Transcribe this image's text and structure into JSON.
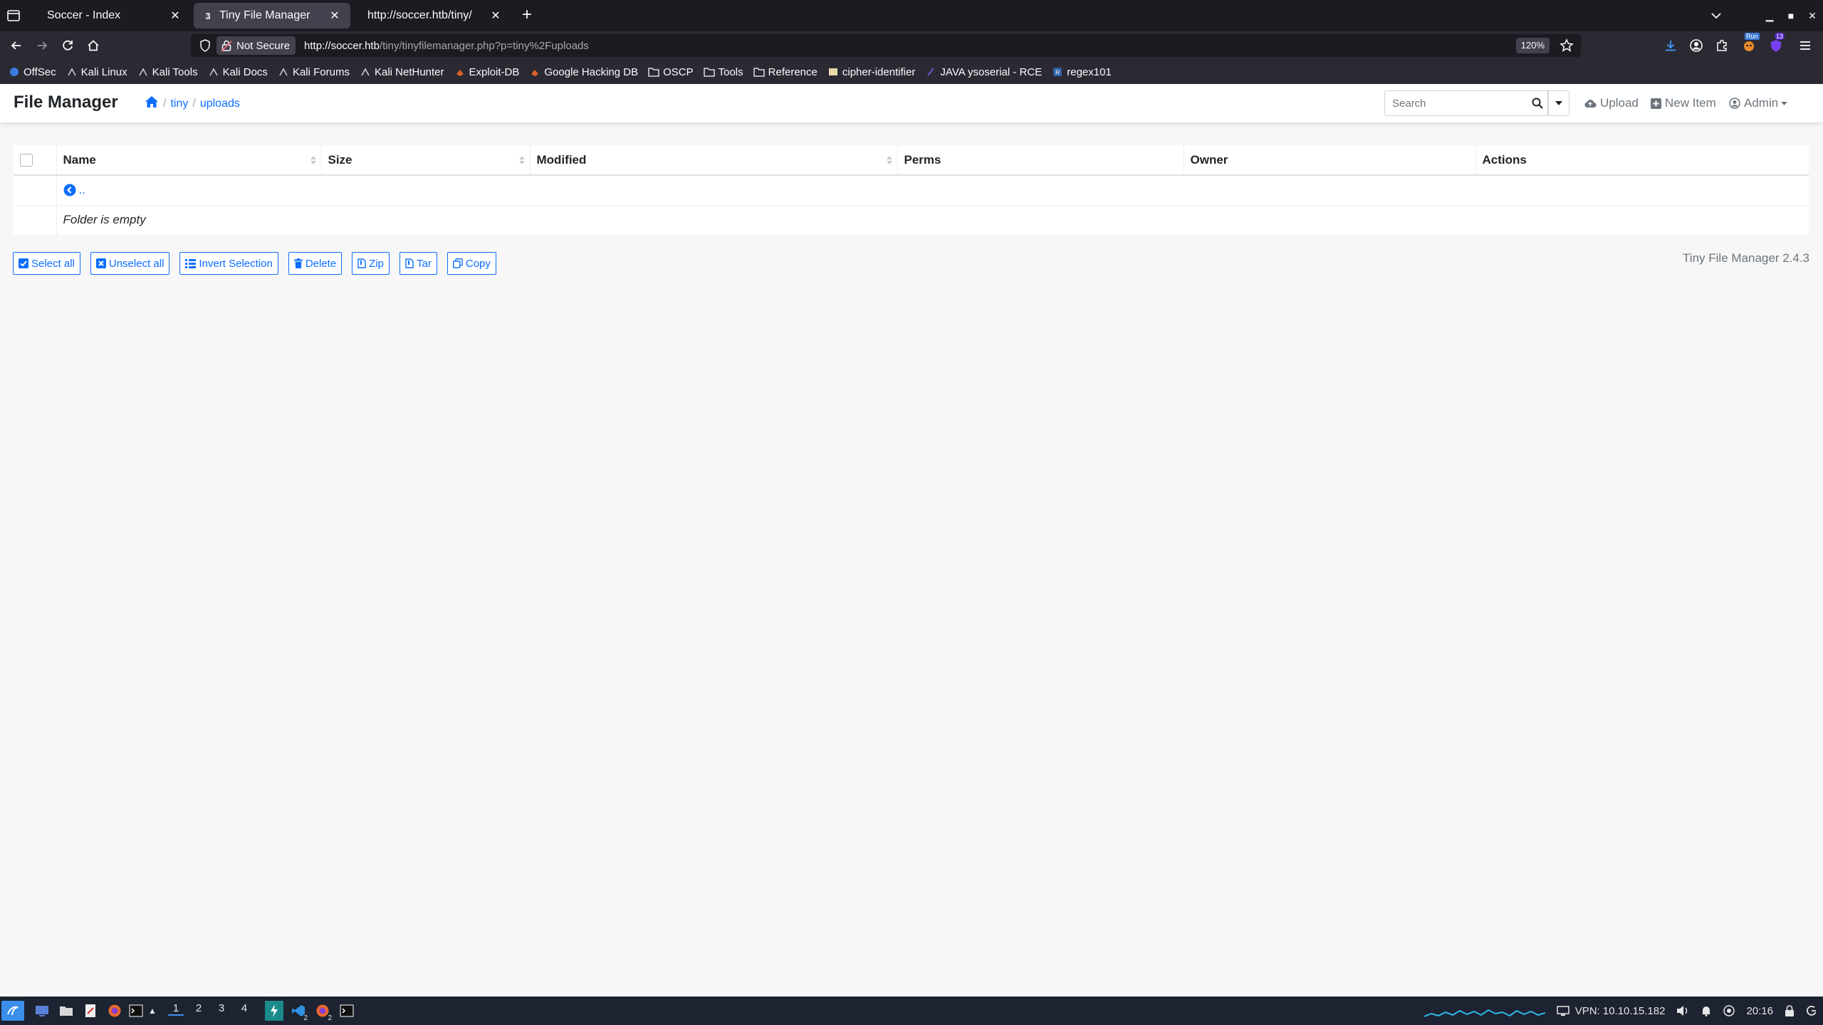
{
  "browser": {
    "tabs": [
      {
        "label": "Soccer - Index",
        "active": false
      },
      {
        "label": "Tiny File Manager",
        "active": true
      },
      {
        "label": "http://soccer.htb/tiny/",
        "active": false
      }
    ],
    "security_label": "Not Secure",
    "url_host": "http://soccer.htb",
    "url_path": "/tiny/tinyfilemanager.php?p=tiny%2Fuploads",
    "zoom": "120%",
    "bookmarks": [
      "OffSec",
      "Kali Linux",
      "Kali Tools",
      "Kali Docs",
      "Kali Forums",
      "Kali NetHunter",
      "Exploit-DB",
      "Google Hacking DB",
      "OSCP",
      "Tools",
      "Reference",
      "cipher-identifier",
      "JAVA ysoserial - RCE",
      "regex101"
    ],
    "extension_badge": "13",
    "ext_badge_2": "Run"
  },
  "app": {
    "brand": "File Manager",
    "breadcrumb": [
      "tiny",
      "uploads"
    ],
    "search_placeholder": "Search",
    "upload_label": "Upload",
    "new_item_label": "New Item",
    "user_label": "Admin"
  },
  "table": {
    "columns": [
      "Name",
      "Size",
      "Modified",
      "Perms",
      "Owner",
      "Actions"
    ],
    "parent_link": "..",
    "empty_message": "Folder is empty"
  },
  "actions": [
    "Select all",
    "Unselect all",
    "Invert Selection",
    "Delete",
    "Zip",
    "Tar",
    "Copy"
  ],
  "version": "Tiny File Manager 2.4.3",
  "taskbar": {
    "workspaces": [
      "1",
      "2",
      "3",
      "4"
    ],
    "vpn": "VPN: 10.10.15.182",
    "clock": "20:16",
    "badge_vscode": "2",
    "badge_firefox": "2"
  },
  "colors": {
    "accent": "#0d6efd",
    "browser_dark": "#1c1b22",
    "toolbar": "#2b2a33",
    "taskbar": "#1d2331"
  }
}
